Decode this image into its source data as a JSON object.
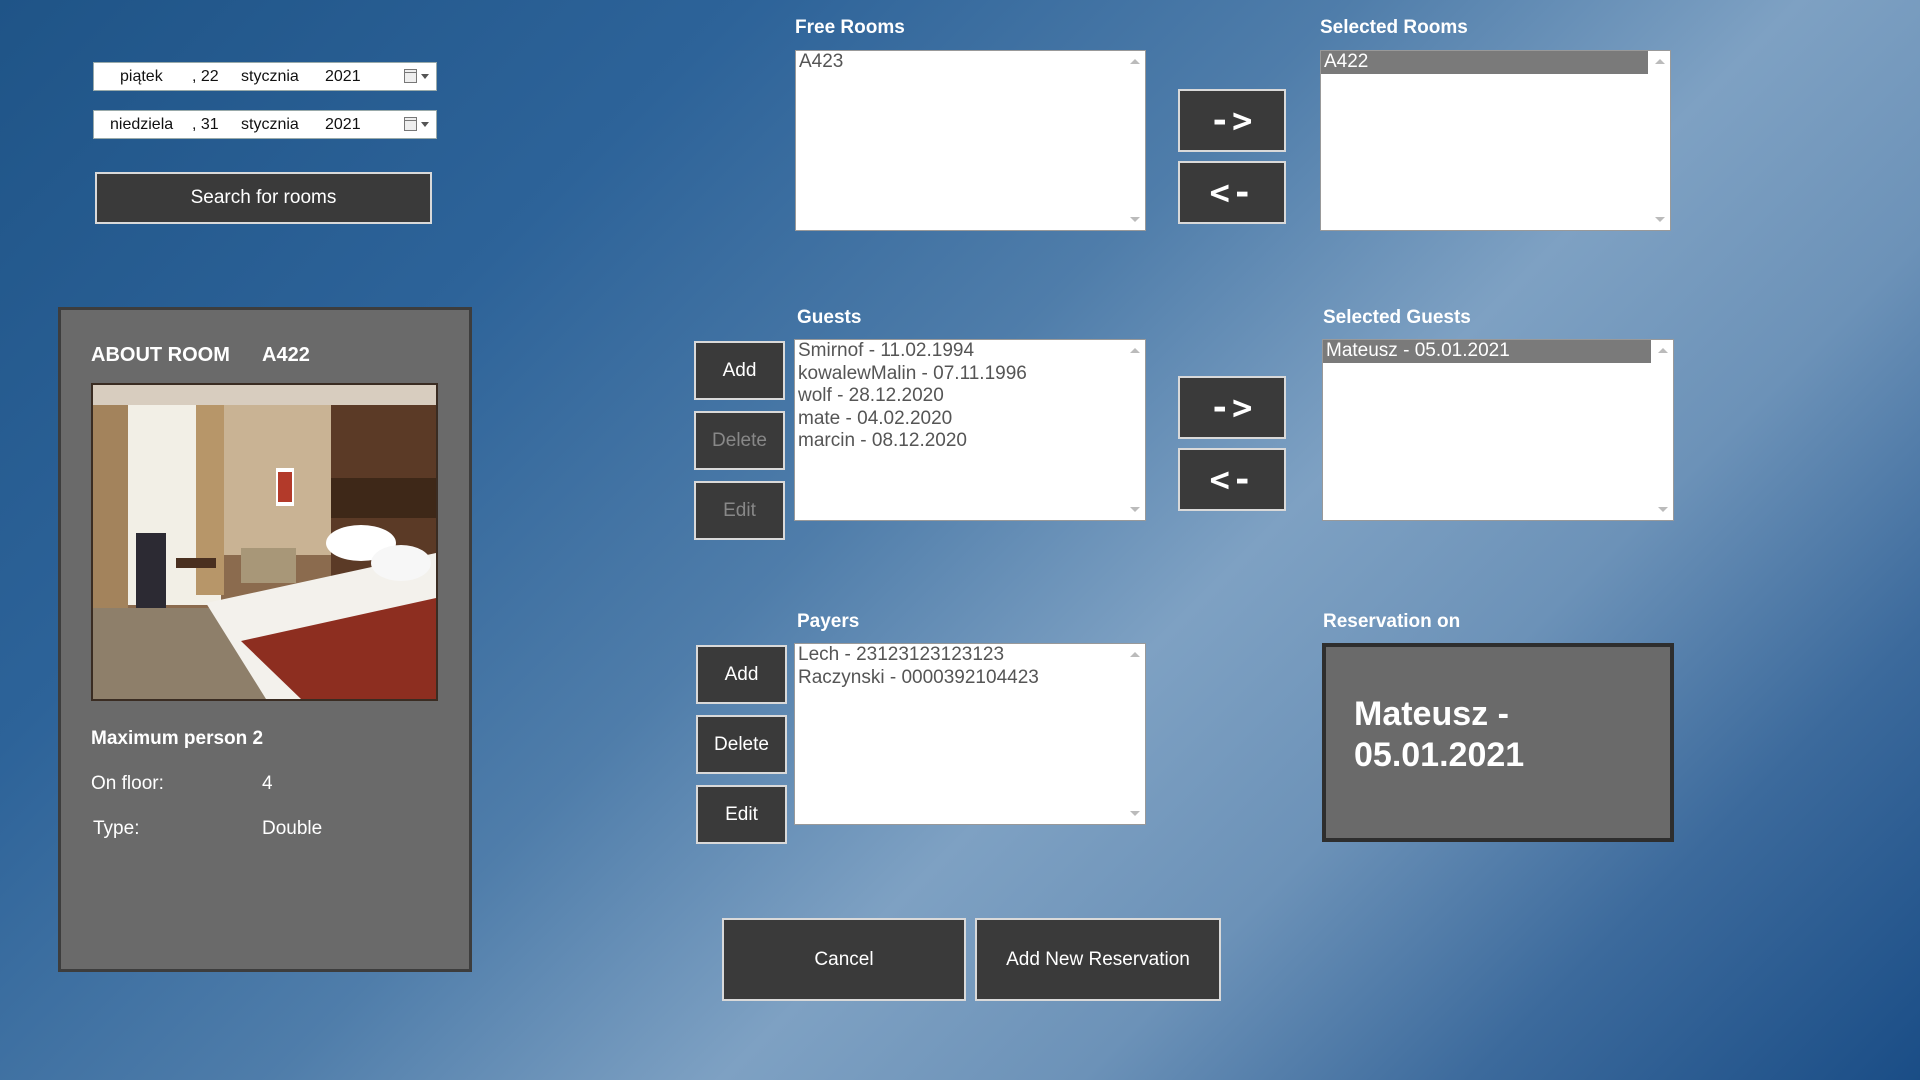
{
  "dates": {
    "from": {
      "day_name": "piątek",
      "day": ", 22",
      "month": "stycznia",
      "year": "2021"
    },
    "to": {
      "day_name": "niedziela",
      "day": ", 31",
      "month": "stycznia",
      "year": "2021"
    }
  },
  "search_button": "Search for rooms",
  "about": {
    "title": "ABOUT ROOM",
    "room": "A422",
    "max_person_label": "Maximum person 2",
    "floor_label": "On floor:",
    "floor_value": "4",
    "type_label": "Type:",
    "type_value": "Double"
  },
  "free_rooms": {
    "label": "Free Rooms",
    "items": [
      "A423"
    ]
  },
  "selected_rooms": {
    "label": "Selected Rooms",
    "items": [
      "A422"
    ]
  },
  "guests": {
    "label": "Guests",
    "items": [
      "Smirnof - 11.02.1994",
      "kowalewMalin - 07.11.1996",
      "wolf - 28.12.2020",
      "mate - 04.02.2020",
      "marcin - 08.12.2020"
    ]
  },
  "selected_guests": {
    "label": "Selected Guests",
    "items": [
      "Mateusz - 05.01.2021"
    ]
  },
  "payers": {
    "label": "Payers",
    "items": [
      "Lech - 23123123123123",
      "Raczynski - 0000392104423"
    ]
  },
  "reservation": {
    "label": "Reservation on",
    "line1": "Mateusz -",
    "line2": "05.01.2021"
  },
  "buttons": {
    "add": "Add",
    "delete": "Delete",
    "edit": "Edit",
    "move_right": "->",
    "move_left": "<-",
    "cancel": "Cancel",
    "add_reservation": "Add New Reservation"
  }
}
